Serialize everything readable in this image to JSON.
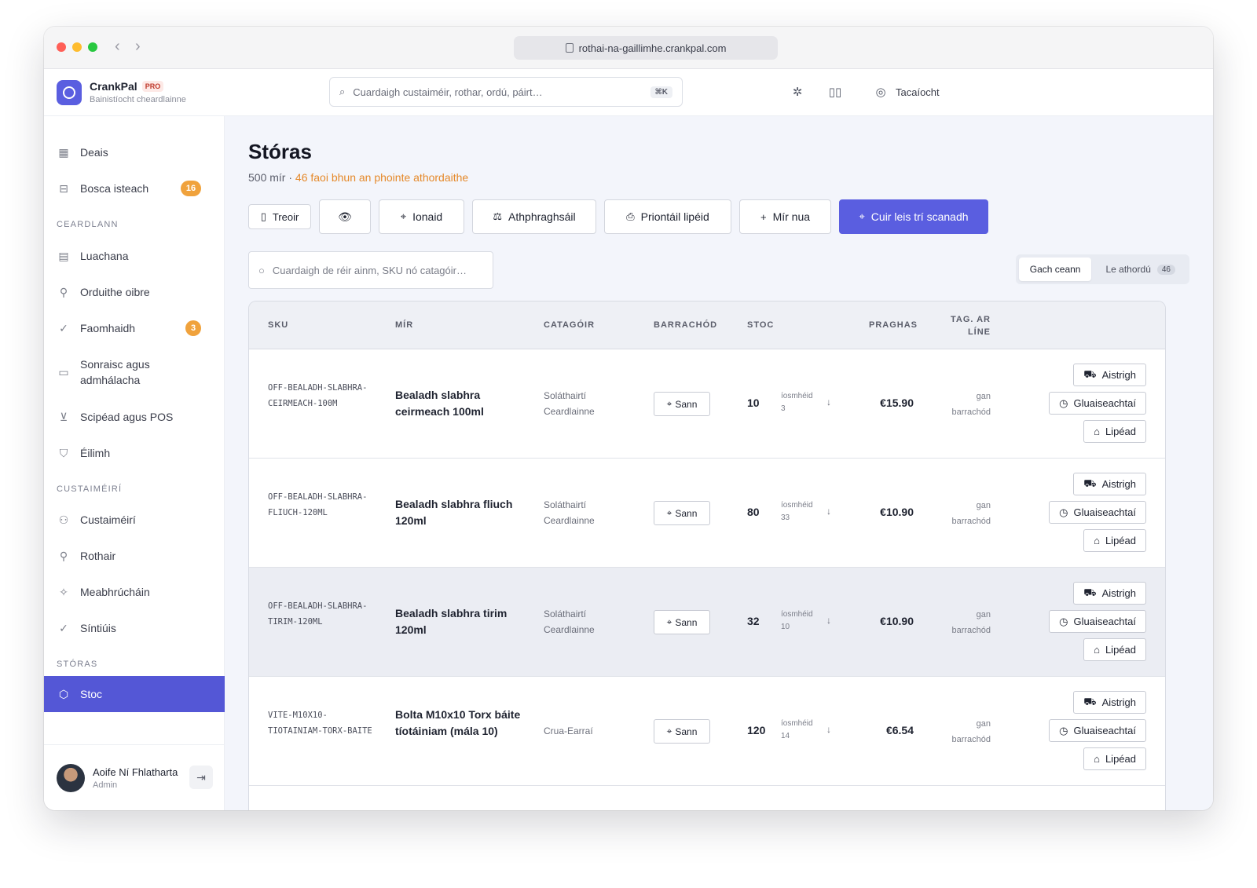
{
  "browser": {
    "url": "rothai-na-gaillimhe.crankpal.com"
  },
  "brand": {
    "name": "CrankPal",
    "badge": "PRO",
    "subtitle": "Bainistíocht cheardlainne"
  },
  "topbar": {
    "search_placeholder": "Cuardaigh custaiméir, rothar, ordú, páirt…",
    "shortcut": "⌘K",
    "support_label": "Tacaíocht"
  },
  "sidebar": {
    "items": [
      {
        "label": "Deais",
        "icon": "dashboard-icon"
      },
      {
        "label": "Bosca isteach",
        "icon": "inbox-icon",
        "badge": "16"
      },
      {
        "label": "Luachana",
        "icon": "document-icon"
      },
      {
        "label": "Orduithe oibre",
        "icon": "wrench-icon"
      },
      {
        "label": "Faomhaidh",
        "icon": "check-circle-icon",
        "badge": "3"
      },
      {
        "label": "Sonraisc agus admhálacha",
        "icon": "receipt-icon"
      },
      {
        "label": "Scipéad agus POS",
        "icon": "cart-icon"
      },
      {
        "label": "Éilimh",
        "icon": "shield-icon"
      },
      {
        "label": "Custaiméirí",
        "icon": "users-icon"
      },
      {
        "label": "Rothair",
        "icon": "bike-icon"
      },
      {
        "label": "Meabhrúcháin",
        "icon": "sparkle-icon"
      },
      {
        "label": "Síntiúis",
        "icon": "check-circle-icon"
      },
      {
        "label": "Stoc",
        "icon": "box-icon"
      }
    ],
    "sections": [
      "CEARDLANN",
      "CUSTAIMÉIRÍ",
      "STÓRAS"
    ],
    "user": {
      "name": "Aoife Ní Fhlatharta",
      "role": "Admin"
    }
  },
  "page": {
    "title": "Stóras",
    "count_text": "500 mír · ",
    "warning_text": "46 faoi bhun an phointe athordaithe"
  },
  "actions": {
    "guide": "Treoir",
    "location": "Ionaid",
    "valuation": "Athphraghsáil",
    "print_labels": "Priontáil lipéid",
    "new_item": "Mír nua",
    "scan_add": "Cuir leis trí scanadh"
  },
  "filters": {
    "search_placeholder": "Cuardaigh de réir ainm, SKU nó catagóir…",
    "all": "Gach ceann",
    "reorder": "Le athordú",
    "reorder_count": "46"
  },
  "table": {
    "headers": {
      "sku": "SKU",
      "item": "MÍR",
      "category": "CATAGÓIR",
      "barcode": "BARRACHÓD",
      "stock": "STOC",
      "price": "PRAGHAS",
      "online_tag": "TAG. AR LÍNE"
    },
    "min_label": "íosmhéid",
    "scan_label": "Sann",
    "no_barcode": "gan barrachód",
    "row_actions": {
      "convert": "Aistrigh",
      "movements": "Gluaiseachtaí",
      "label": "Lipéad"
    },
    "rows": [
      {
        "sku": "OFF-BEALADH-SLABHRA-CEIRMEACH-100M",
        "item": "Bealadh slabhra ceirmeach 100ml",
        "category": "Soláthairtí Ceardlainne",
        "stock": "10",
        "min": "3",
        "price": "€15.90"
      },
      {
        "sku": "OFF-BEALADH-SLABHRA-FLIUCH-120ML",
        "item": "Bealadh slabhra fliuch 120ml",
        "category": "Soláthairtí Ceardlainne",
        "stock": "80",
        "min": "33",
        "price": "€10.90"
      },
      {
        "sku": "OFF-BEALADH-SLABHRA-TIRIM-120ML",
        "item": "Bealadh slabhra tirim 120ml",
        "category": "Soláthairtí Ceardlainne",
        "stock": "32",
        "min": "10",
        "price": "€10.90"
      },
      {
        "sku": "VITE-M10X10-TIOTAINIAM-TORX-BAITE",
        "item": "Bolta M10x10 Torx báite tíotáiniam (mála 10)",
        "category": "Crua-Earraí",
        "stock": "120",
        "min": "14",
        "price": "€6.54"
      }
    ]
  }
}
